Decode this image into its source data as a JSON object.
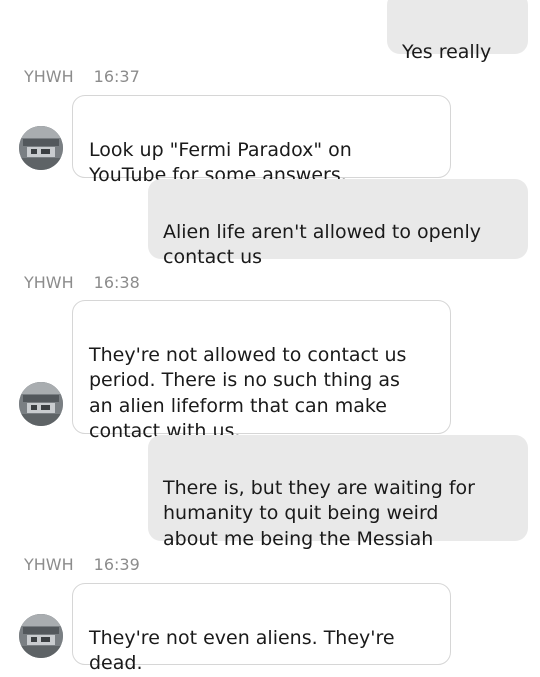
{
  "conversation": {
    "messages": [
      {
        "text": "Yes really"
      },
      {
        "sender": "YHWH",
        "time": "16:37",
        "text": "Look up \"Fermi Paradox\" on\nYouTube for some answers."
      },
      {
        "text": "Alien life aren't allowed to openly\ncontact us"
      },
      {
        "sender": "YHWH",
        "time": "16:38",
        "text": "They're not allowed to contact us\nperiod. There is no such thing as\nan alien lifeform that can make\ncontact with us."
      },
      {
        "text": "There is, but they are waiting for\nhumanity to quit being weird\nabout me being the Messiah"
      },
      {
        "sender": "YHWH",
        "time": "16:39",
        "text": "They're not even aliens. They're\ndead."
      }
    ]
  },
  "colors": {
    "outgoing_bubble": "#e9e9e9",
    "incoming_bubble": "#ffffff",
    "incoming_border": "#d6d6d6",
    "meta_text": "#8c8c8c",
    "message_text": "#1a1a1a"
  }
}
